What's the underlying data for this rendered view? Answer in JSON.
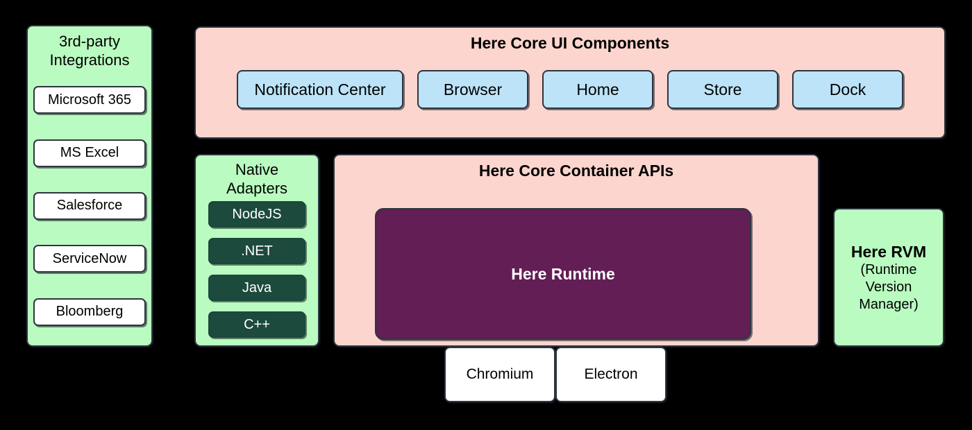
{
  "diagram": {
    "colors": {
      "background": "#000000",
      "group_green": "#b9fbc0",
      "group_pink": "#fbd5ce",
      "chip_blue": "#bce3f8",
      "chip_white": "#ffffff",
      "chip_dark_green": "#1c4a3c",
      "runtime_purple": "#621e55",
      "border": "#2e3440"
    }
  },
  "integrations": {
    "title": "3rd-party\nIntegrations",
    "title_line1": "3rd-party",
    "title_line2": "Integrations",
    "items": [
      {
        "label": "Microsoft 365"
      },
      {
        "label": "MS Excel"
      },
      {
        "label": "Salesforce"
      },
      {
        "label": "ServiceNow"
      },
      {
        "label": "Bloomberg"
      }
    ]
  },
  "ui_components": {
    "title": "Here Core UI Components",
    "items": [
      {
        "label": "Notification Center",
        "width": "wide"
      },
      {
        "label": "Browser",
        "width": "std"
      },
      {
        "label": "Home",
        "width": "std"
      },
      {
        "label": "Store",
        "width": "std"
      },
      {
        "label": "Dock",
        "width": "std"
      }
    ]
  },
  "native_adapters": {
    "title_line1": "Native",
    "title_line2": "Adapters",
    "items": [
      {
        "label": "NodeJS"
      },
      {
        "label": ".NET"
      },
      {
        "label": "Java"
      },
      {
        "label": "C++"
      }
    ]
  },
  "container_apis": {
    "title": "Here Core Container APIs",
    "runtime": {
      "label": "Here Runtime"
    }
  },
  "rvm": {
    "title": "Here RVM",
    "subtitle_line1": "(Runtime",
    "subtitle_line2": "Version",
    "subtitle_line3": "Manager)"
  },
  "foundation": {
    "items": [
      {
        "label": "Chromium"
      },
      {
        "label": "Electron"
      }
    ]
  }
}
